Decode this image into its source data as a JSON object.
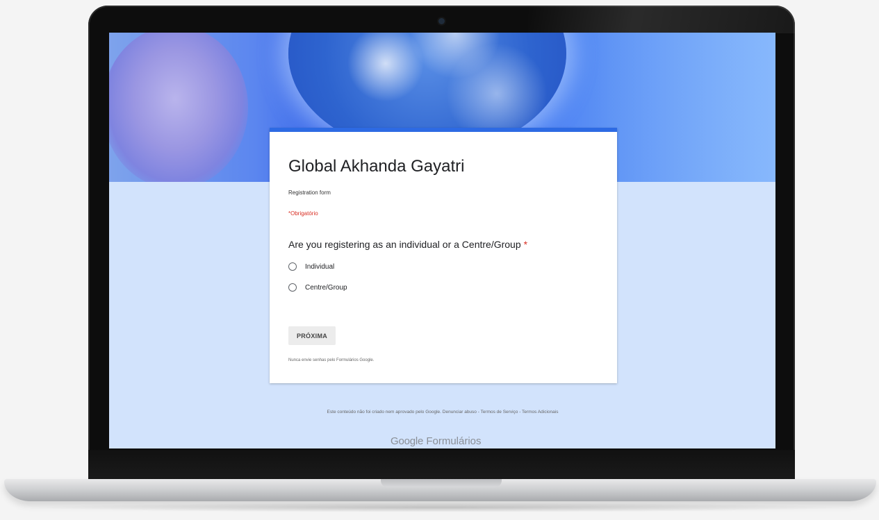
{
  "form": {
    "title": "Global Akhanda Gayatri",
    "description": "Registration form",
    "required_note": "*Obrigatório",
    "question": {
      "text": "Are you registering as an individual or a Centre/Group",
      "required_mark": "*",
      "options": [
        "Individual",
        "Centre/Group"
      ]
    },
    "next_button": "PRÓXIMA",
    "password_warning": "Nunca envie senhas pelo Formulários Google."
  },
  "footer": {
    "disclaimer": "Este conteúdo não foi criado nem aprovado pelo Google. Denunciar abuso - Termos de Serviço - Termos Adicionais",
    "logo_google": "Google",
    "logo_product": "Formulários"
  },
  "colors": {
    "accent": "#2d6ae3",
    "required": "#d93025",
    "page_background": "#d2e3fc"
  },
  "icons": {
    "radio": "radio-unchecked-icon"
  }
}
